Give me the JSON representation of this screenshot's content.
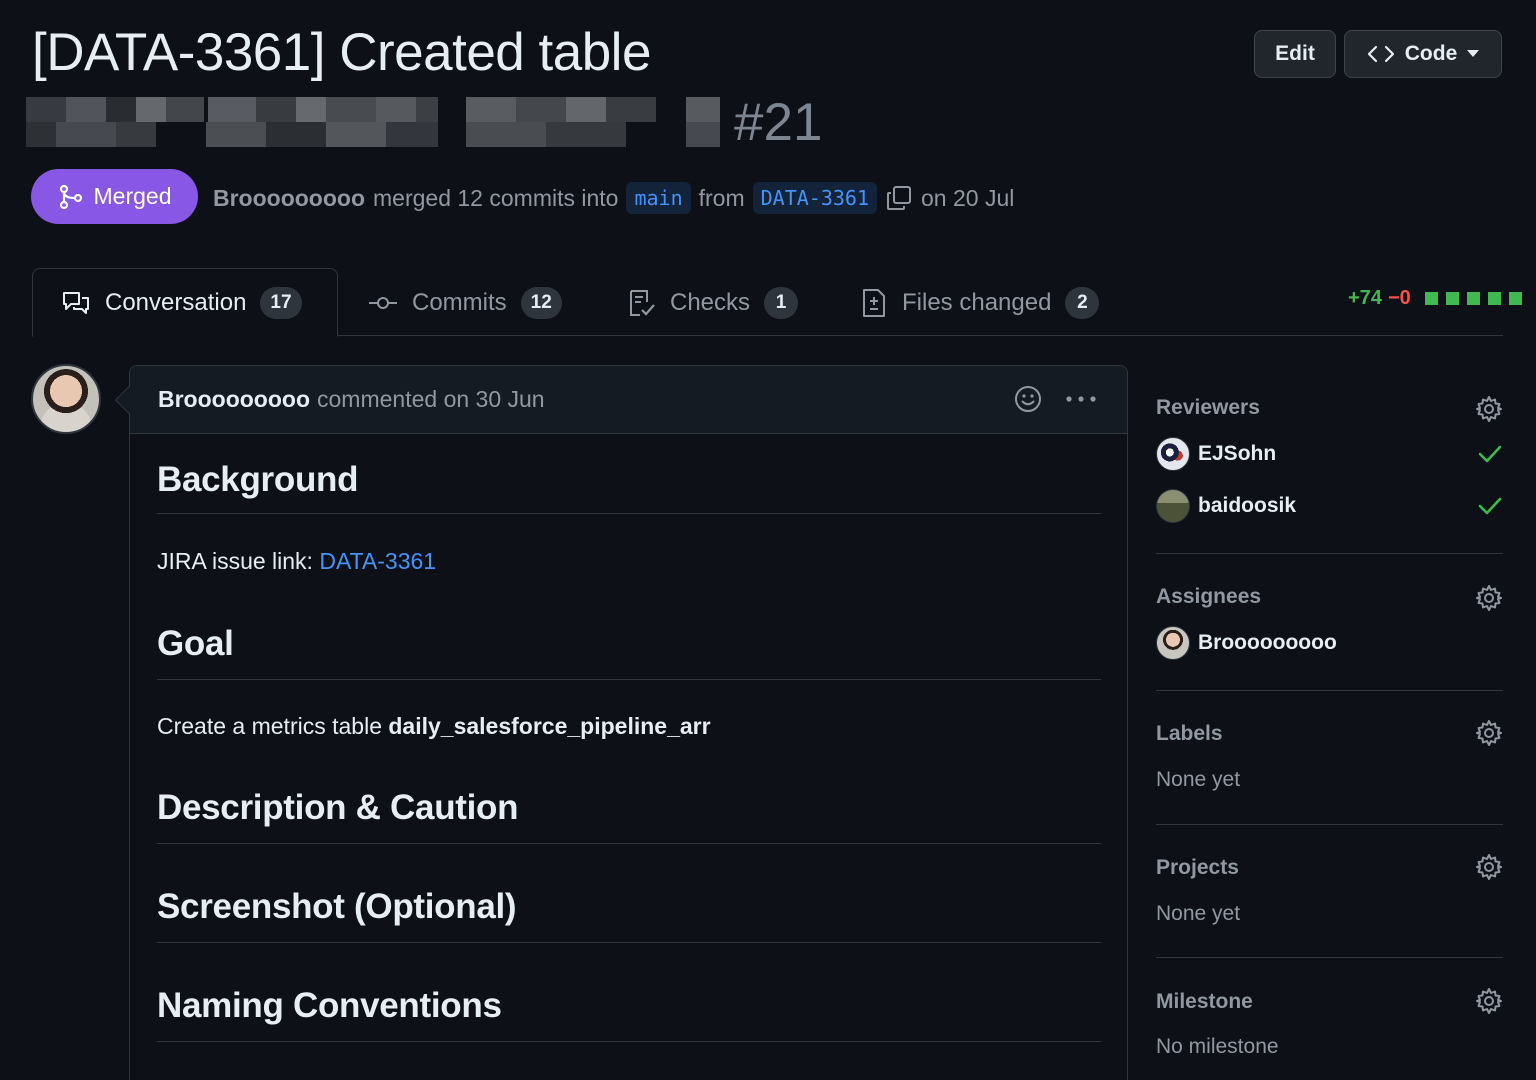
{
  "header": {
    "title": "[DATA-3361] Created table",
    "pr_number": "#21",
    "edit_label": "Edit",
    "code_label": "Code"
  },
  "status": {
    "state": "Merged",
    "author": "Brooooooooo",
    "action_text": "merged 12 commits into",
    "base_branch": "main",
    "from_text": "from",
    "head_branch": "DATA-3361",
    "date_text": "on 20 Jul"
  },
  "tabs": [
    {
      "label": "Conversation",
      "count": "17",
      "icon": "comment-discussion-icon"
    },
    {
      "label": "Commits",
      "count": "12",
      "icon": "git-commit-icon"
    },
    {
      "label": "Checks",
      "count": "1",
      "icon": "checklist-icon"
    },
    {
      "label": "Files changed",
      "count": "2",
      "icon": "file-diff-icon"
    }
  ],
  "diffstat": {
    "additions": "+74",
    "deletions": "−0"
  },
  "comment": {
    "author": "Brooooooooo",
    "meta": "commented on 30 Jun",
    "sections": {
      "background_heading": "Background",
      "jira_label": "JIRA issue link:",
      "jira_link": "DATA-3361",
      "goal_heading": "Goal",
      "goal_text": "Create a metrics table",
      "goal_table": "daily_salesforce_pipeline_arr",
      "description_heading": "Description & Caution",
      "screenshot_heading": "Screenshot (Optional)",
      "naming_heading": "Naming Conventions"
    }
  },
  "sidebar": {
    "reviewers": {
      "heading": "Reviewers",
      "people": [
        {
          "name": "EJSohn",
          "status": "approved"
        },
        {
          "name": "baidoosik",
          "status": "approved"
        }
      ]
    },
    "assignees": {
      "heading": "Assignees",
      "people": [
        {
          "name": "Brooooooooo"
        }
      ]
    },
    "labels": {
      "heading": "Labels",
      "empty": "None yet"
    },
    "projects": {
      "heading": "Projects",
      "empty": "None yet"
    },
    "milestone": {
      "heading": "Milestone",
      "empty": "No milestone"
    }
  },
  "colors": {
    "background": "#0d1117",
    "merged": "#8957e5",
    "link": "#4493f8",
    "success": "#3fb950",
    "danger": "#f85149",
    "muted": "#9198a1"
  }
}
